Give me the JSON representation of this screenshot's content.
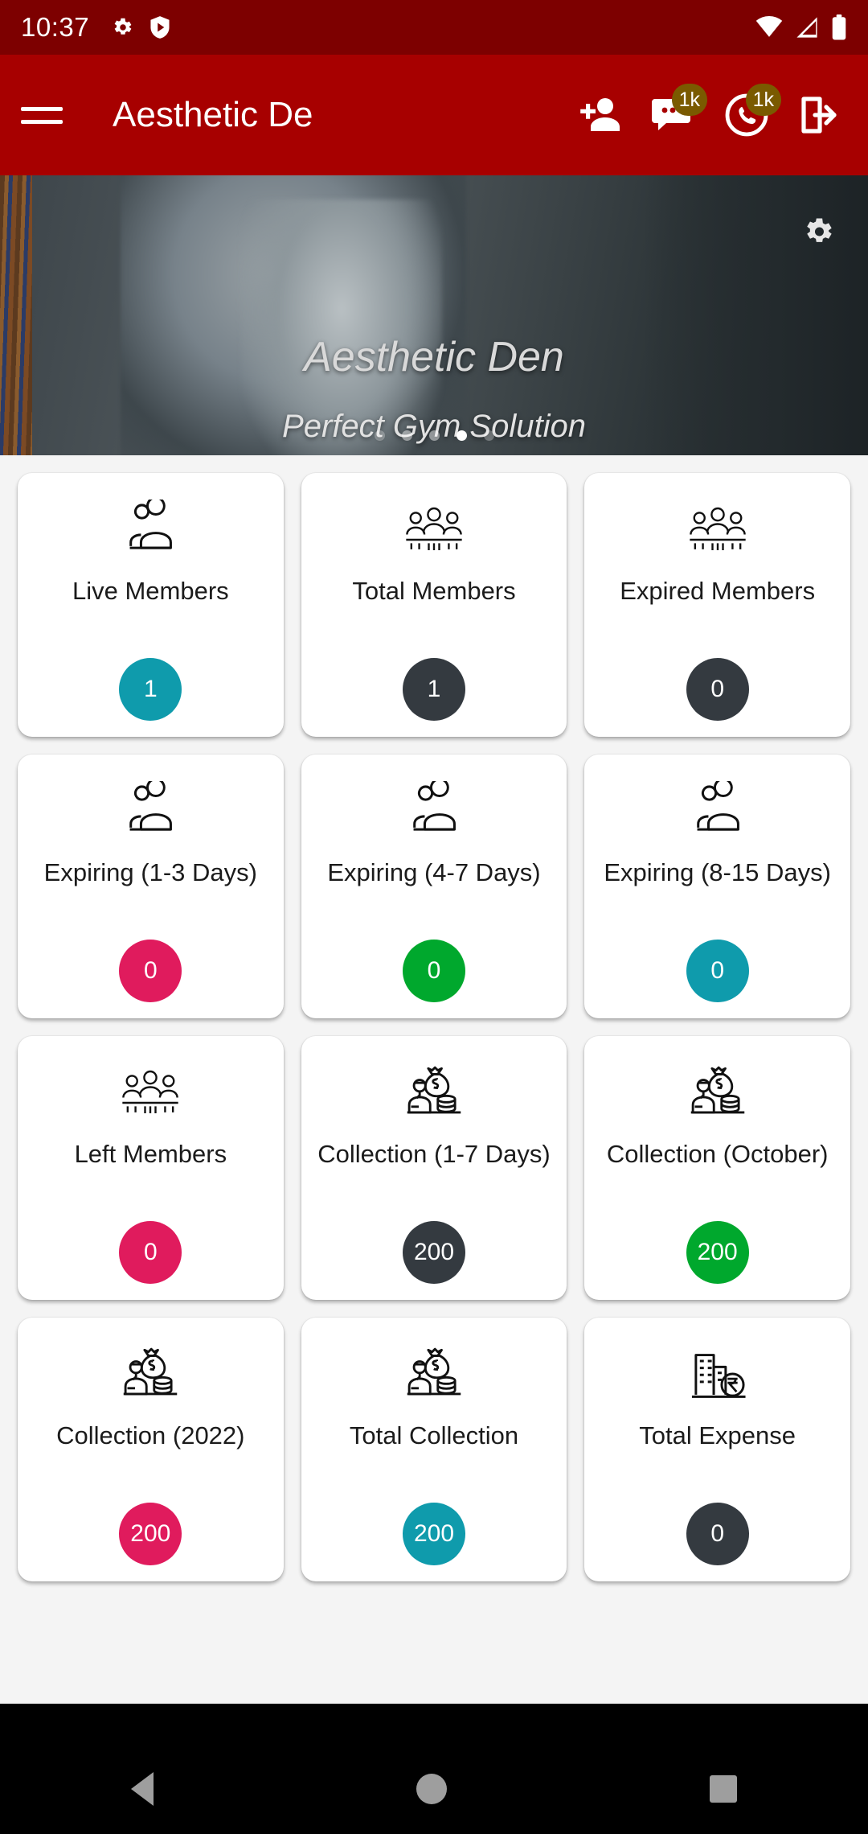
{
  "status_bar": {
    "time": "10:37",
    "left_icons": [
      "gear-icon",
      "play-protect-shield-icon"
    ],
    "right_icons": [
      "wifi-icon",
      "signal-icon",
      "battery-icon"
    ],
    "background_color": "#7d0000"
  },
  "app_bar": {
    "menu_icon": "hamburger-menu-icon",
    "title": "Aesthetic De",
    "background_color": "#a70000",
    "actions": [
      {
        "name": "add-member-icon",
        "badge": null
      },
      {
        "name": "sms-chat-icon",
        "badge": "1k"
      },
      {
        "name": "whatsapp-icon",
        "badge": "1k"
      },
      {
        "name": "logout-icon",
        "badge": null
      }
    ]
  },
  "hero": {
    "title": "Aesthetic Den",
    "subtitle": "Perfect Gym Solution",
    "settings_icon": "gear-icon",
    "dots": {
      "count": 5,
      "active_index": 3
    }
  },
  "cards": [
    {
      "label": "Live Members",
      "value": "1",
      "color": "#0f9bac",
      "icon": "two-people-icon"
    },
    {
      "label": "Total Members",
      "value": "1",
      "color": "#343a40",
      "icon": "group-people-icon"
    },
    {
      "label": "Expired Members",
      "value": "0",
      "color": "#343a40",
      "icon": "group-people-icon"
    },
    {
      "label": "Expiring (1-3 Days)",
      "value": "0",
      "color": "#e01b5d",
      "icon": "two-people-icon"
    },
    {
      "label": "Expiring (4-7 Days)",
      "value": "0",
      "color": "#00a82d",
      "icon": "two-people-icon"
    },
    {
      "label": "Expiring (8-15 Days)",
      "value": "0",
      "color": "#0f9bac",
      "icon": "two-people-icon"
    },
    {
      "label": "Left Members",
      "value": "0",
      "color": "#e01b5d",
      "icon": "group-people-icon"
    },
    {
      "label": "Collection (1-7 Days)",
      "value": "200",
      "color": "#343a40",
      "icon": "money-bag-person-icon"
    },
    {
      "label": "Collection (October)",
      "value": "200",
      "color": "#00a82d",
      "icon": "money-bag-person-icon"
    },
    {
      "label": "Collection (2022)",
      "value": "200",
      "color": "#e01b5d",
      "icon": "money-bag-person-icon"
    },
    {
      "label": "Total Collection",
      "value": "200",
      "color": "#0f9bac",
      "icon": "money-bag-person-icon"
    },
    {
      "label": "Total Expense",
      "value": "0",
      "color": "#343a40",
      "icon": "building-rupee-icon"
    }
  ],
  "nav_bar": {
    "back": "back-triangle-icon",
    "home": "home-circle-icon",
    "recents": "recents-square-icon"
  }
}
